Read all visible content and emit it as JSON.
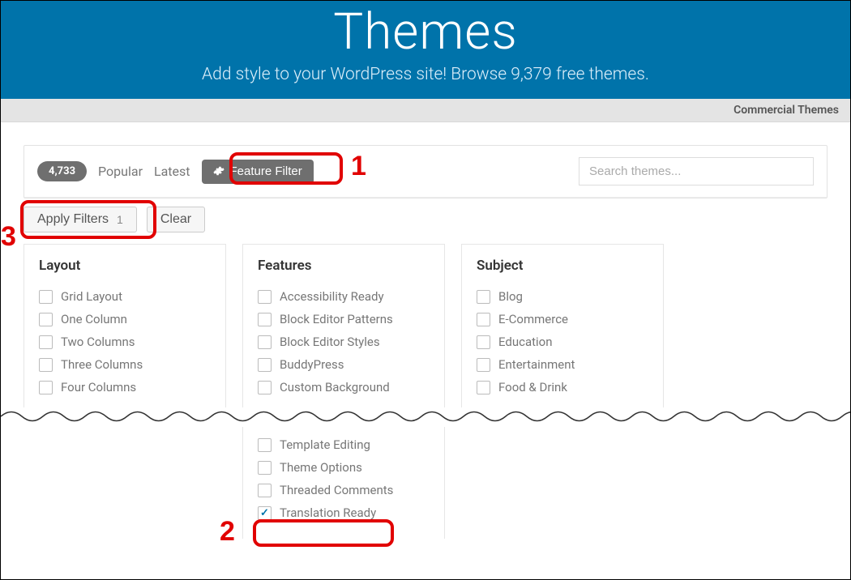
{
  "hero": {
    "title": "Themes",
    "subtitle": "Add style to your WordPress site! Browse 9,379 free themes."
  },
  "subnav": {
    "commercial": "Commercial Themes"
  },
  "toolbar": {
    "count": "4,733",
    "popular": "Popular",
    "latest": "Latest",
    "feature_filter": "Feature Filter",
    "search_placeholder": "Search themes..."
  },
  "filters_bar": {
    "apply": "Apply Filters",
    "apply_count": "1",
    "clear": "Clear"
  },
  "columns": {
    "layout": {
      "title": "Layout",
      "items": [
        {
          "label": "Grid Layout",
          "checked": false
        },
        {
          "label": "One Column",
          "checked": false
        },
        {
          "label": "Two Columns",
          "checked": false
        },
        {
          "label": "Three Columns",
          "checked": false
        },
        {
          "label": "Four Columns",
          "checked": false
        }
      ]
    },
    "features": {
      "title": "Features",
      "items": [
        {
          "label": "Accessibility Ready",
          "checked": false
        },
        {
          "label": "Block Editor Patterns",
          "checked": false
        },
        {
          "label": "Block Editor Styles",
          "checked": false
        },
        {
          "label": "BuddyPress",
          "checked": false
        },
        {
          "label": "Custom Background",
          "checked": false
        }
      ]
    },
    "subject": {
      "title": "Subject",
      "items": [
        {
          "label": "Blog",
          "checked": false
        },
        {
          "label": "E-Commerce",
          "checked": false
        },
        {
          "label": "Education",
          "checked": false
        },
        {
          "label": "Entertainment",
          "checked": false
        },
        {
          "label": "Food & Drink",
          "checked": false
        }
      ]
    }
  },
  "lower_features": [
    {
      "label": "Template Editing",
      "checked": false
    },
    {
      "label": "Theme Options",
      "checked": false
    },
    {
      "label": "Threaded Comments",
      "checked": false
    },
    {
      "label": "Translation Ready",
      "checked": true
    }
  ],
  "annotations": {
    "n1": "1",
    "n2": "2",
    "n3": "3"
  }
}
